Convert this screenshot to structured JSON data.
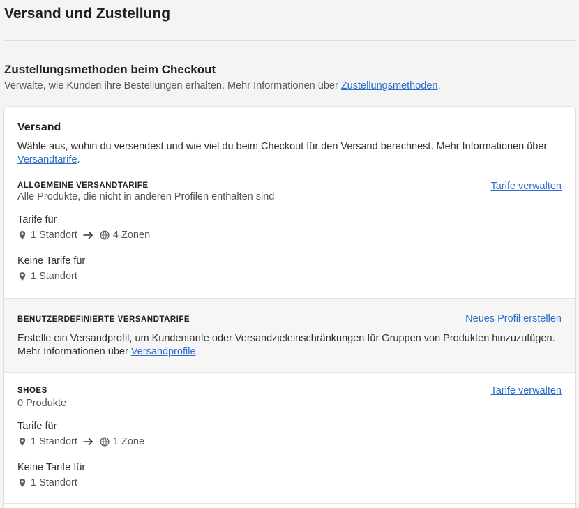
{
  "header": {
    "title": "Versand und Zustellung"
  },
  "delivery_methods": {
    "title": "Zustellungsmethoden beim Checkout",
    "desc_prefix": "Verwalte, wie Kunden ihre Bestellungen erhalten. Mehr Informationen über ",
    "desc_link": "Zustellungsmethoden",
    "desc_suffix": "."
  },
  "shipping_card": {
    "title": "Versand",
    "desc_prefix": "Wähle aus, wohin du versendest und wie viel du beim Checkout für den Versand berechnest. Mehr Informationen über ",
    "desc_link": "Versandtarife",
    "desc_suffix": ".",
    "general": {
      "heading": "Allgemeine Versandtarife",
      "subtitle": "Alle Produkte, die nicht in anderen Profilen enthalten sind",
      "action": "Tarife verwalten",
      "rates_label": "Tarife für",
      "rates_locations": "1 Standort",
      "rates_zones": "4 Zonen",
      "no_rates_label": "Keine Tarife für",
      "no_rates_locations": "1 Standort"
    },
    "custom": {
      "heading": "Benutzerdefinierte Versandtarife",
      "action": "Neues Profil erstellen",
      "desc_prefix": "Erstelle ein Versandprofil, um Kundentarife oder Versandzieleinschränkungen für Gruppen von Produkten hinzuzufügen. Mehr Informationen über ",
      "desc_link": "Versandprofile",
      "desc_suffix": "."
    },
    "shoes": {
      "heading": "Shoes",
      "subtitle": "0 Produkte",
      "action": "Tarife verwalten",
      "rates_label": "Tarife für",
      "rates_locations": "1 Standort",
      "rates_zones": "1 Zone",
      "no_rates_label": "Keine Tarife für",
      "no_rates_locations": "1 Standort"
    }
  },
  "icons": {
    "location": "location-pin-icon",
    "globe": "globe-icon",
    "arrow": "arrow-right-icon"
  },
  "colors": {
    "link": "#2c6ecb",
    "background": "#f4f4f4",
    "card": "#ffffff"
  }
}
